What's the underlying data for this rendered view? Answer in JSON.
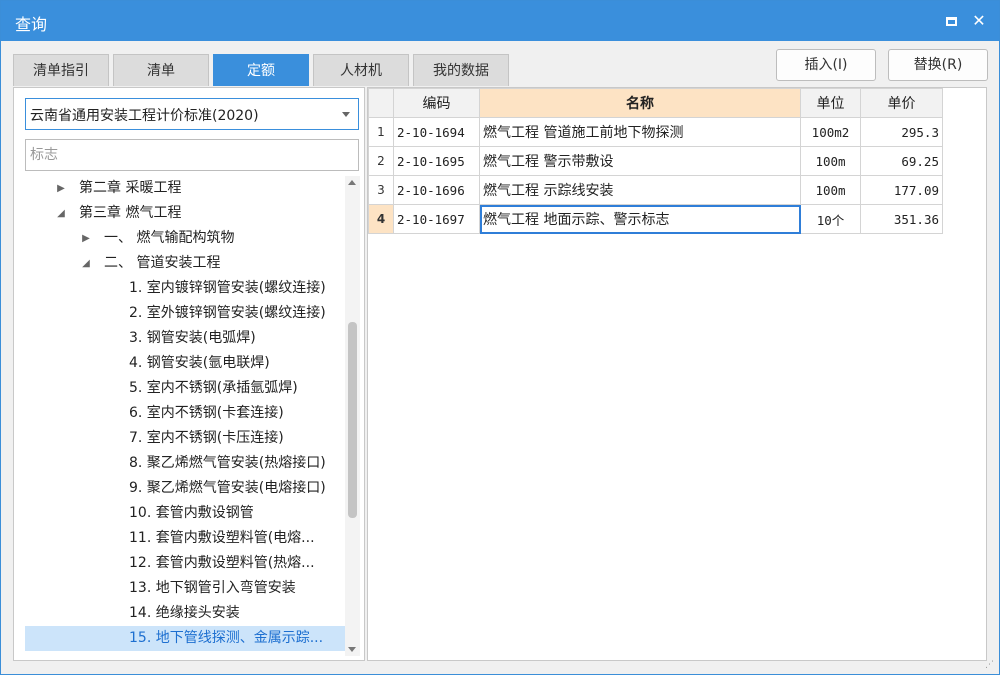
{
  "window": {
    "title": "查询"
  },
  "tabs": [
    "清单指引",
    "清单",
    "定额",
    "人材机",
    "我的数据"
  ],
  "actions": {
    "insert": "插入(I)",
    "replace": "替换(R)"
  },
  "left": {
    "standard_select": "云南省通用安装工程计价标准(2020)",
    "search_placeholder": "标志",
    "tree": [
      {
        "label": "第二章 采暖工程",
        "caret": "▶"
      },
      {
        "label": "第三章 燃气工程",
        "caret": "◢"
      },
      {
        "label": "一、 燃气输配构筑物",
        "caret": "▶"
      },
      {
        "label": "二、 管道安装工程",
        "caret": "◢"
      },
      {
        "label": "1. 室内镀锌钢管安装(螺纹连接)"
      },
      {
        "label": "2. 室外镀锌钢管安装(螺纹连接)"
      },
      {
        "label": "3. 钢管安装(电弧焊)"
      },
      {
        "label": "4. 钢管安装(氩电联焊)"
      },
      {
        "label": "5. 室内不锈钢(承插氩弧焊)"
      },
      {
        "label": "6. 室内不锈钢(卡套连接)"
      },
      {
        "label": "7. 室内不锈钢(卡压连接)"
      },
      {
        "label": "8. 聚乙烯燃气管安装(热熔接口)"
      },
      {
        "label": "9. 聚乙烯燃气管安装(电熔接口)"
      },
      {
        "label": "10. 套管内敷设钢管"
      },
      {
        "label": "11. 套管内敷设塑料管(电熔..."
      },
      {
        "label": "12. 套管内敷设塑料管(热熔..."
      },
      {
        "label": "13. 地下钢管引入弯管安装"
      },
      {
        "label": "14. 绝缘接头安装"
      },
      {
        "label": "15. 地下管线探测、金属示踪..."
      }
    ]
  },
  "grid": {
    "headers": {
      "code": "编码",
      "name": "名称",
      "unit": "单位",
      "price": "单价"
    },
    "rows": [
      {
        "no": "1",
        "code": "2-10-1694",
        "name": "燃气工程 管道施工前地下物探测",
        "unit": "100m2",
        "price": "295.3"
      },
      {
        "no": "2",
        "code": "2-10-1695",
        "name": "燃气工程 警示带敷设",
        "unit": "100m",
        "price": "69.25"
      },
      {
        "no": "3",
        "code": "2-10-1696",
        "name": "燃气工程 示踪线安装",
        "unit": "100m",
        "price": "177.09"
      },
      {
        "no": "4",
        "code": "2-10-1697",
        "name": "燃气工程 地面示踪、警示标志",
        "unit": "10个",
        "price": "351.36"
      }
    ]
  }
}
